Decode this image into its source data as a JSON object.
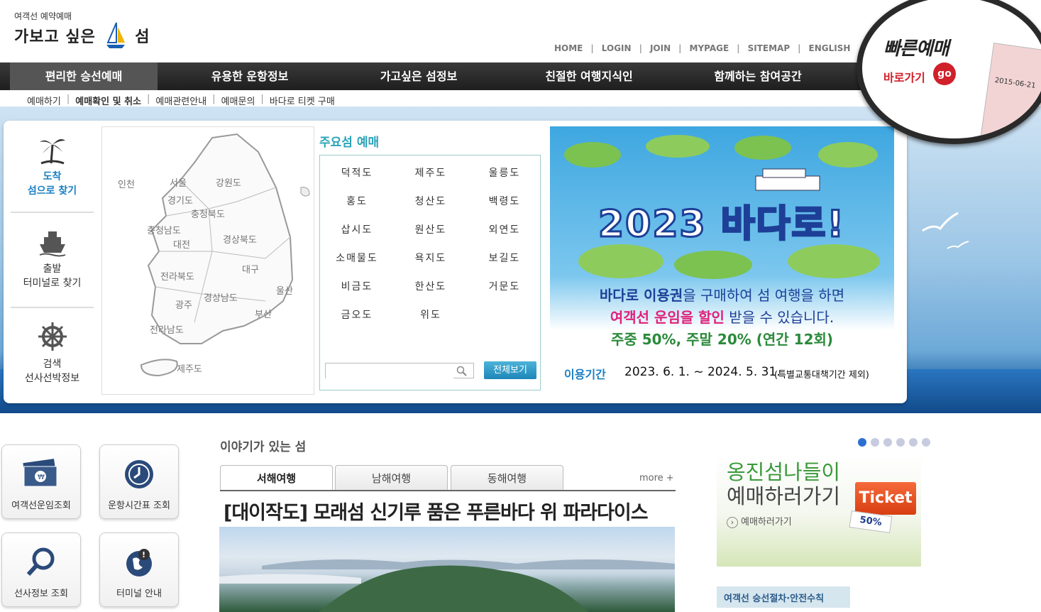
{
  "header": {
    "logo_subtitle": "여객선 예약예매",
    "logo_title_1": "가보고 싶은",
    "logo_title_2": "섬",
    "top_links": [
      "HOME",
      "LOGIN",
      "JOIN",
      "MYPAGE",
      "SITEMAP",
      "ENGLISH"
    ]
  },
  "gnb": [
    "편리한 승선예매",
    "유용한 운항정보",
    "가고싶은 섬정보",
    "친절한 여행지식인",
    "함께하는 참여공간"
  ],
  "subnav": [
    "예매하기",
    "예매확인 및 취소",
    "예매관련안내",
    "예매문의",
    "바다로 티켓 구매"
  ],
  "quick": {
    "title": "빠른예매",
    "go_label": "바로가기",
    "go_btn": "go",
    "ticket_date": "2015-06-21"
  },
  "search_tabs": [
    {
      "line1": "도착",
      "line2": "섬으로 찾기"
    },
    {
      "line1": "출발",
      "line2": "터미널로 찾기"
    },
    {
      "line1": "검색",
      "line2": "선사선박정보"
    }
  ],
  "map_labels": [
    "인천",
    "서울",
    "강원도",
    "경기도",
    "충청북도",
    "충청남도",
    "대전",
    "경상북도",
    "대구",
    "전라북도",
    "울산",
    "경상남도",
    "광주",
    "부산",
    "전라남도",
    "제주도"
  ],
  "islands": {
    "title": "주요섬 예매",
    "items": [
      "덕적도",
      "제주도",
      "울릉도",
      "홍도",
      "청산도",
      "백령도",
      "삽시도",
      "원산도",
      "외연도",
      "소매물도",
      "욕지도",
      "보길도",
      "비금도",
      "한산도",
      "거문도",
      "금오도",
      "위도"
    ],
    "search_placeholder": "",
    "view_all": "전체보기"
  },
  "banner": {
    "title": "2023 바다로!",
    "line1_a": "바다로 이용권",
    "line1_b": "을 구매하여 섬 여행을 하면",
    "line2_a": "여객선 운임을 할인",
    "line2_b": " 받을 수 있습니다.",
    "line3": "주중 50%, 주말 20% (연간 12회)",
    "period_label": "이용기간",
    "period_value": "2023. 6. 1. ~ 2024. 5. 31.",
    "period_note": "(특별교통대책기간 제외)"
  },
  "quick_buttons": [
    "여객선운임조회",
    "운항시간표 조회",
    "선사정보 조회",
    "터미널 안내"
  ],
  "story": {
    "title": "이야기가 있는 섬",
    "tabs": [
      "서해여행",
      "남해여행",
      "동해여행"
    ],
    "more": "more +",
    "headline": "[대이작도] 모래섬 신기루 품은 푸른바다 위 파라다이스"
  },
  "side_banner": {
    "line1": "옹진섬나들이",
    "line2": "예매하러가기",
    "link": "예매하러가기",
    "ticket": "Ticket",
    "discount": "50%",
    "safety": "여객선 승선절차·안전수칙"
  },
  "colors": {
    "accent": "#1a7fc4",
    "teal": "#2aa3b8",
    "red": "#d0202a",
    "green": "#3a9a3a"
  }
}
